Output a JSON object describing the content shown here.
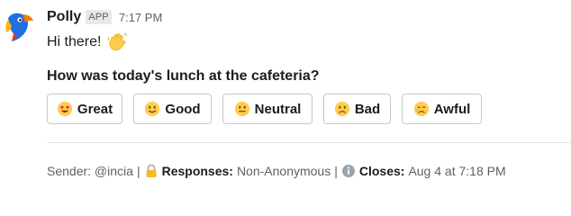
{
  "message": {
    "sender": "Polly",
    "badge": "APP",
    "time": "7:17 PM",
    "greeting": "Hi there!",
    "question": "How was today's lunch at the cafeteria?"
  },
  "buttons": [
    {
      "label": "Great",
      "icon": "heart-eyes-emoji"
    },
    {
      "label": "Good",
      "icon": "slightly-smiling-emoji"
    },
    {
      "label": "Neutral",
      "icon": "neutral-face-emoji"
    },
    {
      "label": "Bad",
      "icon": "slightly-frowning-emoji"
    },
    {
      "label": "Awful",
      "icon": "crying-face-emoji"
    }
  ],
  "context": {
    "sender_text": "Sender: @incia",
    "sep": "|",
    "responses_label": "Responses:",
    "responses_value": "Non-Anonymous",
    "closes_label": "Closes:",
    "closes_value": "Aug 4 at 7:18 PM"
  },
  "colors": {
    "text": "#1d1c1d",
    "muted": "#616061",
    "emoji_yellow": "#ffcc4d",
    "parrot_blue": "#1a73e8",
    "parrot_orange": "#f57c00"
  }
}
